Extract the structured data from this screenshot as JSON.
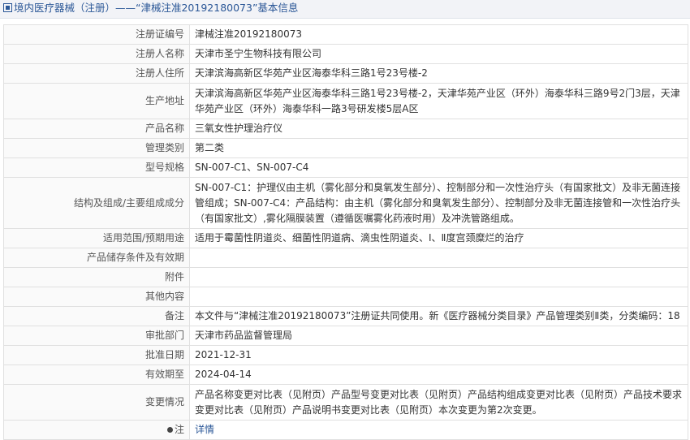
{
  "header": {
    "title": "境内医疗器械（注册）——“津械注准20192180073”基本信息"
  },
  "rows": [
    {
      "label": "注册证编号",
      "value": "津械注准20192180073"
    },
    {
      "label": "注册人名称",
      "value": "天津市圣宁生物科技有限公司"
    },
    {
      "label": "注册人住所",
      "value": "天津滨海高新区华苑产业区海泰华科三路1号23号楼-2"
    },
    {
      "label": "生产地址",
      "value": "天津滨海高新区华苑产业区海泰华科三路1号23号楼-2，天津华苑产业区（环外）海泰华科三路9号2门3层，天津华苑产业区（环外）海泰华科一路3号研发楼5层A区"
    },
    {
      "label": "产品名称",
      "value": "三氧女性护理治疗仪"
    },
    {
      "label": "管理类别",
      "value": "第二类"
    },
    {
      "label": "型号规格",
      "value": "SN-007-C1、SN-007-C4"
    },
    {
      "label": "结构及组成/主要组成成分",
      "value": "SN-007-C1：护理仪由主机（雾化部分和臭氧发生部分）、控制部分和一次性治疗头（有国家批文）及非无菌连接管组成；SN-007-C4：产品结构：由主机（雾化部分和臭氧发生部分）、控制部分及非无菌连接管和一次性治疗头（有国家批文）,雾化隔膜装置（遵循医嘱雾化药液时用）及冲洗管路组成。"
    },
    {
      "label": "适用范围/预期用途",
      "value": "适用于霉菌性阴道炎、细菌性阴道病、滴虫性阴道炎、Ⅰ、Ⅱ度宫颈糜烂的治疗"
    },
    {
      "label": "产品储存条件及有效期",
      "value": ""
    },
    {
      "label": "附件",
      "value": ""
    },
    {
      "label": "其他内容",
      "value": ""
    },
    {
      "label": "备注",
      "value": "本文件与“津械注准20192180073”注册证共同使用。新《医疗器械分类目录》产品管理类别Ⅱ类，分类编码：18"
    },
    {
      "label": "审批部门",
      "value": "天津市药品监督管理局"
    },
    {
      "label": "批准日期",
      "value": "2021-12-31"
    },
    {
      "label": "有效期至",
      "value": "2024-04-14"
    },
    {
      "label": "变更情况",
      "value": "产品名称变更对比表（见附页）产品型号变更对比表（见附页）产品结构组成变更对比表（见附页）产品技术要求变更对比表（见附页）产品说明书变更对比表（见附页）本次变更为第2次变更。"
    }
  ],
  "note": {
    "label": "注",
    "icon": "pin-icon",
    "link_text": "详情",
    "link_color": "#2b5797"
  }
}
